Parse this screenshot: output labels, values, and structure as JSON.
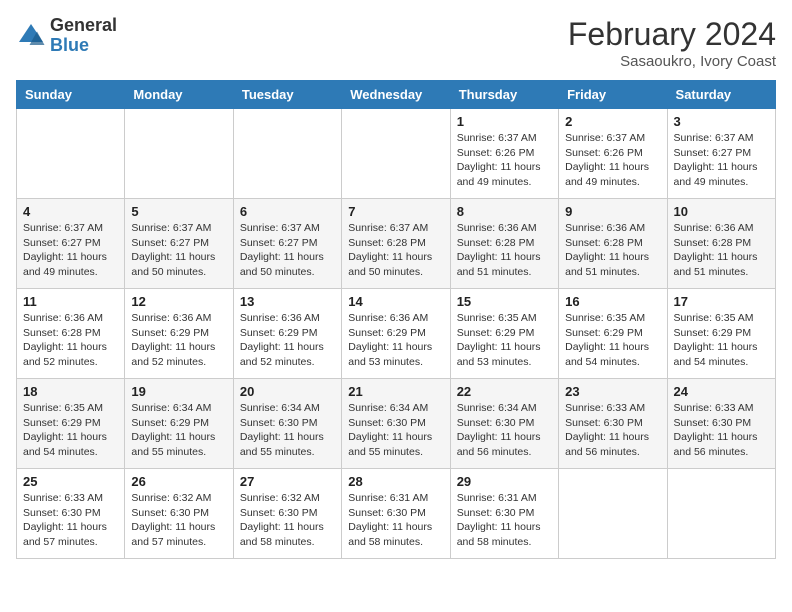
{
  "header": {
    "logo_general": "General",
    "logo_blue": "Blue",
    "month_year": "February 2024",
    "location": "Sasaoukro, Ivory Coast"
  },
  "days_of_week": [
    "Sunday",
    "Monday",
    "Tuesday",
    "Wednesday",
    "Thursday",
    "Friday",
    "Saturday"
  ],
  "weeks": [
    [
      {
        "day": "",
        "sunrise": "",
        "sunset": "",
        "daylight": ""
      },
      {
        "day": "",
        "sunrise": "",
        "sunset": "",
        "daylight": ""
      },
      {
        "day": "",
        "sunrise": "",
        "sunset": "",
        "daylight": ""
      },
      {
        "day": "",
        "sunrise": "",
        "sunset": "",
        "daylight": ""
      },
      {
        "day": "1",
        "sunrise": "Sunrise: 6:37 AM",
        "sunset": "Sunset: 6:26 PM",
        "daylight": "Daylight: 11 hours and 49 minutes."
      },
      {
        "day": "2",
        "sunrise": "Sunrise: 6:37 AM",
        "sunset": "Sunset: 6:26 PM",
        "daylight": "Daylight: 11 hours and 49 minutes."
      },
      {
        "day": "3",
        "sunrise": "Sunrise: 6:37 AM",
        "sunset": "Sunset: 6:27 PM",
        "daylight": "Daylight: 11 hours and 49 minutes."
      }
    ],
    [
      {
        "day": "4",
        "sunrise": "Sunrise: 6:37 AM",
        "sunset": "Sunset: 6:27 PM",
        "daylight": "Daylight: 11 hours and 49 minutes."
      },
      {
        "day": "5",
        "sunrise": "Sunrise: 6:37 AM",
        "sunset": "Sunset: 6:27 PM",
        "daylight": "Daylight: 11 hours and 50 minutes."
      },
      {
        "day": "6",
        "sunrise": "Sunrise: 6:37 AM",
        "sunset": "Sunset: 6:27 PM",
        "daylight": "Daylight: 11 hours and 50 minutes."
      },
      {
        "day": "7",
        "sunrise": "Sunrise: 6:37 AM",
        "sunset": "Sunset: 6:28 PM",
        "daylight": "Daylight: 11 hours and 50 minutes."
      },
      {
        "day": "8",
        "sunrise": "Sunrise: 6:36 AM",
        "sunset": "Sunset: 6:28 PM",
        "daylight": "Daylight: 11 hours and 51 minutes."
      },
      {
        "day": "9",
        "sunrise": "Sunrise: 6:36 AM",
        "sunset": "Sunset: 6:28 PM",
        "daylight": "Daylight: 11 hours and 51 minutes."
      },
      {
        "day": "10",
        "sunrise": "Sunrise: 6:36 AM",
        "sunset": "Sunset: 6:28 PM",
        "daylight": "Daylight: 11 hours and 51 minutes."
      }
    ],
    [
      {
        "day": "11",
        "sunrise": "Sunrise: 6:36 AM",
        "sunset": "Sunset: 6:28 PM",
        "daylight": "Daylight: 11 hours and 52 minutes."
      },
      {
        "day": "12",
        "sunrise": "Sunrise: 6:36 AM",
        "sunset": "Sunset: 6:29 PM",
        "daylight": "Daylight: 11 hours and 52 minutes."
      },
      {
        "day": "13",
        "sunrise": "Sunrise: 6:36 AM",
        "sunset": "Sunset: 6:29 PM",
        "daylight": "Daylight: 11 hours and 52 minutes."
      },
      {
        "day": "14",
        "sunrise": "Sunrise: 6:36 AM",
        "sunset": "Sunset: 6:29 PM",
        "daylight": "Daylight: 11 hours and 53 minutes."
      },
      {
        "day": "15",
        "sunrise": "Sunrise: 6:35 AM",
        "sunset": "Sunset: 6:29 PM",
        "daylight": "Daylight: 11 hours and 53 minutes."
      },
      {
        "day": "16",
        "sunrise": "Sunrise: 6:35 AM",
        "sunset": "Sunset: 6:29 PM",
        "daylight": "Daylight: 11 hours and 54 minutes."
      },
      {
        "day": "17",
        "sunrise": "Sunrise: 6:35 AM",
        "sunset": "Sunset: 6:29 PM",
        "daylight": "Daylight: 11 hours and 54 minutes."
      }
    ],
    [
      {
        "day": "18",
        "sunrise": "Sunrise: 6:35 AM",
        "sunset": "Sunset: 6:29 PM",
        "daylight": "Daylight: 11 hours and 54 minutes."
      },
      {
        "day": "19",
        "sunrise": "Sunrise: 6:34 AM",
        "sunset": "Sunset: 6:29 PM",
        "daylight": "Daylight: 11 hours and 55 minutes."
      },
      {
        "day": "20",
        "sunrise": "Sunrise: 6:34 AM",
        "sunset": "Sunset: 6:30 PM",
        "daylight": "Daylight: 11 hours and 55 minutes."
      },
      {
        "day": "21",
        "sunrise": "Sunrise: 6:34 AM",
        "sunset": "Sunset: 6:30 PM",
        "daylight": "Daylight: 11 hours and 55 minutes."
      },
      {
        "day": "22",
        "sunrise": "Sunrise: 6:34 AM",
        "sunset": "Sunset: 6:30 PM",
        "daylight": "Daylight: 11 hours and 56 minutes."
      },
      {
        "day": "23",
        "sunrise": "Sunrise: 6:33 AM",
        "sunset": "Sunset: 6:30 PM",
        "daylight": "Daylight: 11 hours and 56 minutes."
      },
      {
        "day": "24",
        "sunrise": "Sunrise: 6:33 AM",
        "sunset": "Sunset: 6:30 PM",
        "daylight": "Daylight: 11 hours and 56 minutes."
      }
    ],
    [
      {
        "day": "25",
        "sunrise": "Sunrise: 6:33 AM",
        "sunset": "Sunset: 6:30 PM",
        "daylight": "Daylight: 11 hours and 57 minutes."
      },
      {
        "day": "26",
        "sunrise": "Sunrise: 6:32 AM",
        "sunset": "Sunset: 6:30 PM",
        "daylight": "Daylight: 11 hours and 57 minutes."
      },
      {
        "day": "27",
        "sunrise": "Sunrise: 6:32 AM",
        "sunset": "Sunset: 6:30 PM",
        "daylight": "Daylight: 11 hours and 58 minutes."
      },
      {
        "day": "28",
        "sunrise": "Sunrise: 6:31 AM",
        "sunset": "Sunset: 6:30 PM",
        "daylight": "Daylight: 11 hours and 58 minutes."
      },
      {
        "day": "29",
        "sunrise": "Sunrise: 6:31 AM",
        "sunset": "Sunset: 6:30 PM",
        "daylight": "Daylight: 11 hours and 58 minutes."
      },
      {
        "day": "",
        "sunrise": "",
        "sunset": "",
        "daylight": ""
      },
      {
        "day": "",
        "sunrise": "",
        "sunset": "",
        "daylight": ""
      }
    ]
  ]
}
